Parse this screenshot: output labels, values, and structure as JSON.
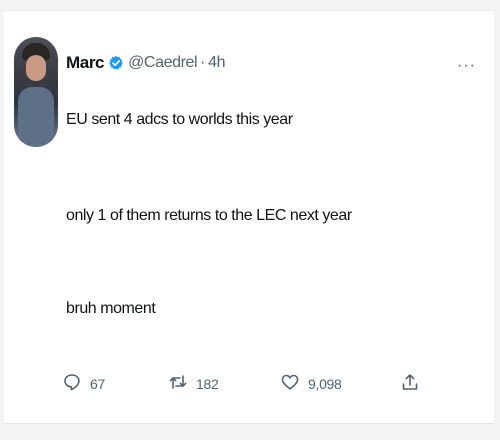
{
  "tweet": {
    "author_name": "Marc",
    "handle": "@Caedrel",
    "separator": "·",
    "time": "4h",
    "more_label": "···",
    "lines": [
      "EU sent 4 adcs to worlds this year",
      "only 1 of them returns to the LEC next year",
      "bruh moment"
    ],
    "verified_icon": "verified-badge-icon",
    "accent_color": "#1d9bf0"
  },
  "actions": {
    "reply_count": "67",
    "retweet_count": "182",
    "like_count": "9,098",
    "reply_icon": "reply-icon",
    "retweet_icon": "retweet-icon",
    "like_icon": "heart-icon",
    "share_icon": "share-icon"
  }
}
